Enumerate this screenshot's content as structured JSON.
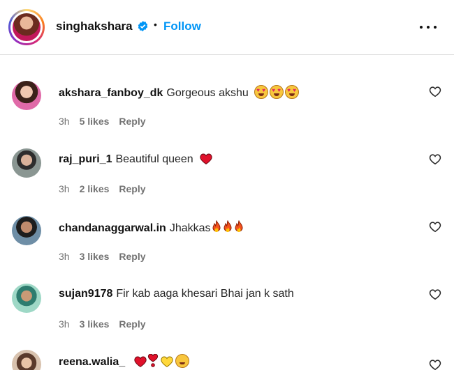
{
  "header": {
    "username": "singhakshara",
    "follow_label": "Follow",
    "separator": "•"
  },
  "comments": [
    {
      "username": "akshara_fanboy_dk",
      "text": "Gorgeous akshu",
      "emoji": [
        "heart-eyes",
        "heart-eyes",
        "heart-eyes"
      ],
      "time": "3h",
      "likes": "5 likes",
      "reply": "Reply",
      "avatar_color": "#c25b9b"
    },
    {
      "username": "raj_puri_1",
      "text": "Beautiful queen",
      "emoji": [
        "red-heart"
      ],
      "time": "3h",
      "likes": "2 likes",
      "reply": "Reply",
      "avatar_color": "#6d7a76"
    },
    {
      "username": "chandanaggarwal.in",
      "text": "Jhakkas",
      "emoji": [
        "fire",
        "fire",
        "fire"
      ],
      "time": "3h",
      "likes": "3 likes",
      "reply": "Reply",
      "avatar_color": "#4b6f86"
    },
    {
      "username": "sujan9178",
      "text": "Fir kab aaga khesari Bhai jan k sath",
      "emoji": [],
      "time": "3h",
      "likes": "3 likes",
      "reply": "Reply",
      "avatar_color": "#3aa6a0"
    },
    {
      "username": "reena.walia_",
      "text": "",
      "emoji": [
        "red-heart",
        "heart-exclamation",
        "yellow-heart",
        "smiling-face"
      ],
      "time": "",
      "likes": "",
      "reply": "",
      "avatar_color": "#c9a98e"
    }
  ],
  "colors": {
    "follow": "#0095f6",
    "verified": "#0095f6",
    "meta_text": "#737373",
    "divider": "#dbdbdb"
  }
}
